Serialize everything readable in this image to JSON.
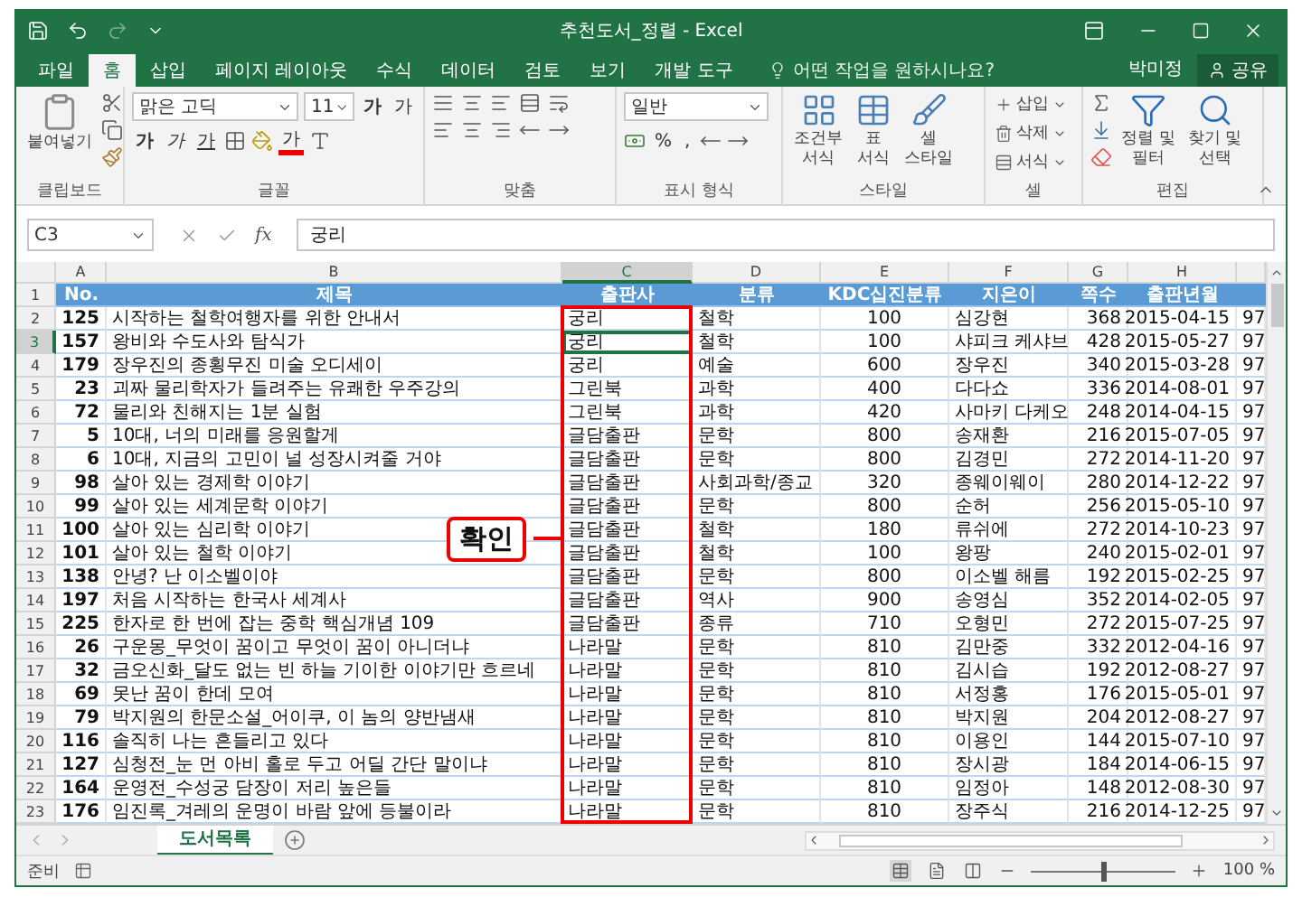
{
  "window": {
    "title": "추천도서_정렬 - Excel"
  },
  "menu_tabs": [
    {
      "label": "파일",
      "selected": false
    },
    {
      "label": "홈",
      "selected": true
    },
    {
      "label": "삽입",
      "selected": false
    },
    {
      "label": "페이지 레이아웃",
      "selected": false
    },
    {
      "label": "수식",
      "selected": false
    },
    {
      "label": "데이터",
      "selected": false
    },
    {
      "label": "검토",
      "selected": false
    },
    {
      "label": "보기",
      "selected": false
    },
    {
      "label": "개발 도구",
      "selected": false
    }
  ],
  "tell_me": "어떤 작업을 원하시나요?",
  "user": "박미정",
  "share_button": "공유",
  "ribbon": {
    "clipboard": {
      "paste": "붙여넣기",
      "label": "클립보드"
    },
    "font": {
      "name": "맑은 고딕",
      "size": "11",
      "grow": "가",
      "shrink": "가",
      "bold": "가",
      "italic": "가",
      "underline": "가",
      "font_color_button": "가",
      "label": "글꼴"
    },
    "alignment": {
      "label": "맞춤"
    },
    "number": {
      "format": "일반",
      "percent": "%",
      "comma": ",",
      "label": "표시 형식"
    },
    "styles": {
      "buttons": [
        {
          "lines": [
            "조건부",
            "서식"
          ]
        },
        {
          "lines": [
            "표",
            "서식"
          ]
        },
        {
          "lines": [
            "셀",
            "스타일"
          ]
        }
      ],
      "label": "스타일"
    },
    "cells": {
      "buttons": [
        "삽입",
        "삭제",
        "서식"
      ],
      "label": "셀"
    },
    "editing": {
      "buttons": [
        {
          "lines": [
            "정렬 및",
            "필터"
          ]
        },
        {
          "lines": [
            "찾기 및",
            "선택"
          ]
        }
      ],
      "label": "편집"
    }
  },
  "formula_bar": {
    "name_box": "C3",
    "fx": "fx",
    "value": "궁리"
  },
  "columns": [
    {
      "letter": "A",
      "selected": false
    },
    {
      "letter": "B",
      "selected": false
    },
    {
      "letter": "C",
      "selected": true
    },
    {
      "letter": "D",
      "selected": false
    },
    {
      "letter": "E",
      "selected": false
    },
    {
      "letter": "F",
      "selected": false
    },
    {
      "letter": "G",
      "selected": false
    },
    {
      "letter": "H",
      "selected": false
    }
  ],
  "header_row": {
    "number": "1",
    "cells": [
      "No.",
      "제목",
      "출판사",
      "분류",
      "KDC십진분류",
      "지은이",
      "쪽수",
      "출판년월"
    ]
  },
  "rows": [
    {
      "number": "2",
      "selected": false,
      "cells": [
        "125",
        "시작하는 철학여행자를 위한 안내서",
        "궁리",
        "철학",
        "100",
        "심강현",
        "368",
        "2015-04-15",
        "97"
      ]
    },
    {
      "number": "3",
      "selected": true,
      "cells": [
        "157",
        "왕비와 수도사와 탐식가",
        "궁리",
        "철학",
        "100",
        "샤피크 케샤브",
        "428",
        "2015-05-27",
        "97"
      ]
    },
    {
      "number": "4",
      "selected": false,
      "cells": [
        "179",
        "장우진의 종횡무진 미술 오디세이",
        "궁리",
        "예술",
        "600",
        "장우진",
        "340",
        "2015-03-28",
        "97"
      ]
    },
    {
      "number": "5",
      "selected": false,
      "cells": [
        "23",
        "괴짜 물리학자가 들려주는 유쾌한 우주강의",
        "그린북",
        "과학",
        "400",
        "다다쇼",
        "336",
        "2014-08-01",
        "97"
      ]
    },
    {
      "number": "6",
      "selected": false,
      "cells": [
        "72",
        "물리와 친해지는 1분 실험",
        "그린북",
        "과학",
        "420",
        "사마키 다케오",
        "248",
        "2014-04-15",
        "97"
      ]
    },
    {
      "number": "7",
      "selected": false,
      "cells": [
        "5",
        "10대, 너의 미래를 응원할게",
        "글담출판",
        "문학",
        "800",
        "송재환",
        "216",
        "2015-07-05",
        "97"
      ]
    },
    {
      "number": "8",
      "selected": false,
      "cells": [
        "6",
        "10대, 지금의 고민이 널 성장시켜줄 거야",
        "글담출판",
        "문학",
        "800",
        "김경민",
        "272",
        "2014-11-20",
        "97"
      ]
    },
    {
      "number": "9",
      "selected": false,
      "cells": [
        "98",
        "살아 있는 경제학 이야기",
        "글담출판",
        "사회과학/종교",
        "320",
        "종웨이웨이",
        "280",
        "2014-12-22",
        "97"
      ]
    },
    {
      "number": "10",
      "selected": false,
      "cells": [
        "99",
        "살아 있는 세계문학 이야기",
        "글담출판",
        "문학",
        "800",
        "순허",
        "256",
        "2015-05-10",
        "97"
      ]
    },
    {
      "number": "11",
      "selected": false,
      "cells": [
        "100",
        "살아 있는 심리학 이야기",
        "글담출판",
        "철학",
        "180",
        "류쉬에",
        "272",
        "2014-10-23",
        "97"
      ]
    },
    {
      "number": "12",
      "selected": false,
      "cells": [
        "101",
        "살아 있는 철학 이야기",
        "글담출판",
        "철학",
        "100",
        "왕팡",
        "240",
        "2015-02-01",
        "97"
      ]
    },
    {
      "number": "13",
      "selected": false,
      "cells": [
        "138",
        "안녕? 난 이소벨이야",
        "글담출판",
        "문학",
        "800",
        "이소벨 해름",
        "192",
        "2015-02-25",
        "97"
      ]
    },
    {
      "number": "14",
      "selected": false,
      "cells": [
        "197",
        "처음 시작하는 한국사 세계사",
        "글담출판",
        "역사",
        "900",
        "송영심",
        "352",
        "2014-02-05",
        "97"
      ]
    },
    {
      "number": "15",
      "selected": false,
      "cells": [
        "225",
        "한자로 한 번에 잡는 중학 핵심개념 109",
        "글담출판",
        "종류",
        "710",
        "오형민",
        "272",
        "2015-07-25",
        "97"
      ]
    },
    {
      "number": "16",
      "selected": false,
      "cells": [
        "26",
        "구운몽_무엇이 꿈이고 무엇이 꿈이 아니더냐",
        "나라말",
        "문학",
        "810",
        "김만중",
        "332",
        "2012-04-16",
        "97"
      ]
    },
    {
      "number": "17",
      "selected": false,
      "cells": [
        "32",
        "금오신화_달도 없는 빈 하늘 기이한 이야기만 흐르네",
        "나라말",
        "문학",
        "810",
        "김시습",
        "192",
        "2012-08-27",
        "97"
      ]
    },
    {
      "number": "18",
      "selected": false,
      "cells": [
        "69",
        "못난 꿈이 한데 모여",
        "나라말",
        "문학",
        "810",
        "서정홍",
        "176",
        "2015-05-01",
        "97"
      ]
    },
    {
      "number": "19",
      "selected": false,
      "cells": [
        "79",
        "박지원의 한문소설_어이쿠, 이 놈의 양반냄새",
        "나라말",
        "문학",
        "810",
        "박지원",
        "204",
        "2012-08-27",
        "97"
      ]
    },
    {
      "number": "20",
      "selected": false,
      "cells": [
        "116",
        "솔직히 나는 흔들리고 있다",
        "나라말",
        "문학",
        "810",
        "이용인",
        "144",
        "2015-07-10",
        "97"
      ]
    },
    {
      "number": "21",
      "selected": false,
      "cells": [
        "127",
        "심청전_눈 먼 아비 홀로 두고 어딜 간단 말이냐",
        "나라말",
        "문학",
        "810",
        "장시광",
        "184",
        "2014-06-15",
        "97"
      ]
    },
    {
      "number": "22",
      "selected": false,
      "cells": [
        "164",
        "운영전_수성궁 담장이 저리 높은들",
        "나라말",
        "문학",
        "810",
        "임정아",
        "148",
        "2012-08-30",
        "97"
      ]
    },
    {
      "number": "23",
      "selected": false,
      "cells": [
        "176",
        "임진록_겨레의 운명이 바람 앞에 등불이라",
        "나라말",
        "문학",
        "810",
        "장주식",
        "216",
        "2014-12-25",
        "97"
      ]
    }
  ],
  "callout": "확인",
  "sheet_tabs": [
    {
      "label": "도서목록",
      "selected": true
    }
  ],
  "status_bar": {
    "text": "준비",
    "zoom": "100 %",
    "level": 0.5
  }
}
